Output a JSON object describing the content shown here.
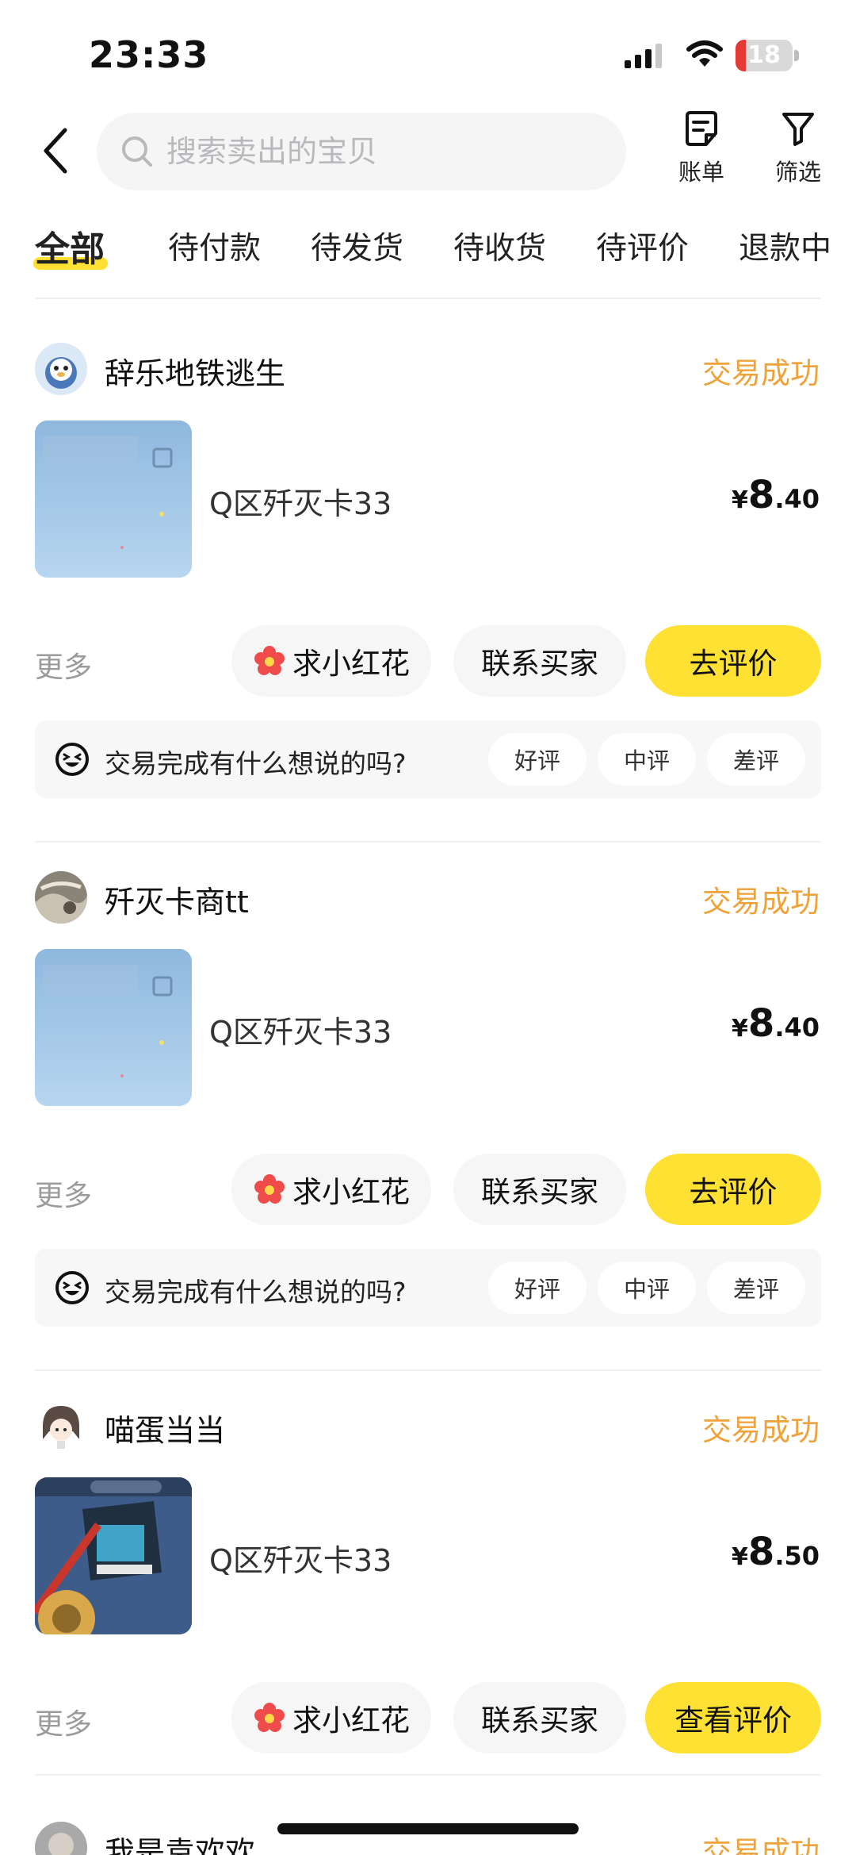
{
  "status_bar": {
    "time": "23:33",
    "battery_level": "18",
    "battery_color": "#e53935"
  },
  "header": {
    "search_placeholder": "搜索卖出的宝贝",
    "bill_label": "账单",
    "filter_label": "筛选"
  },
  "tabs": [
    {
      "label": "全部",
      "active": true
    },
    {
      "label": "待付款",
      "active": false
    },
    {
      "label": "待发货",
      "active": false
    },
    {
      "label": "待收货",
      "active": false
    },
    {
      "label": "待评价",
      "active": false
    },
    {
      "label": "退款中",
      "active": false
    }
  ],
  "orders": [
    {
      "seller": "辞乐地铁逃生",
      "status": "交易成功",
      "title": "Q区歼灭卡33",
      "price_symbol": "¥",
      "price_int": "8",
      "price_dec": ".40",
      "more": "更多",
      "flower": "求小红花",
      "contact": "联系买家",
      "action": "去评价",
      "feedback_prompt": "交易完成有什么想说的吗?",
      "rating_good": "好评",
      "rating_mid": "中评",
      "rating_bad": "差评"
    },
    {
      "seller": "歼灭卡商tt",
      "status": "交易成功",
      "title": "Q区歼灭卡33",
      "price_symbol": "¥",
      "price_int": "8",
      "price_dec": ".40",
      "more": "更多",
      "flower": "求小红花",
      "contact": "联系买家",
      "action": "去评价",
      "feedback_prompt": "交易完成有什么想说的吗?",
      "rating_good": "好评",
      "rating_mid": "中评",
      "rating_bad": "差评"
    },
    {
      "seller": "喵蛋当当",
      "status": "交易成功",
      "title": "Q区歼灭卡33",
      "price_symbol": "¥",
      "price_int": "8",
      "price_dec": ".50",
      "more": "更多",
      "flower": "求小红花",
      "contact": "联系买家",
      "action": "查看评价"
    },
    {
      "seller": "我是袁欢欢",
      "status": "交易成功"
    }
  ],
  "colors": {
    "accent_yellow": "#ffe133",
    "status_orange": "#f0a23a",
    "flower_red": "#ef4b4b"
  }
}
